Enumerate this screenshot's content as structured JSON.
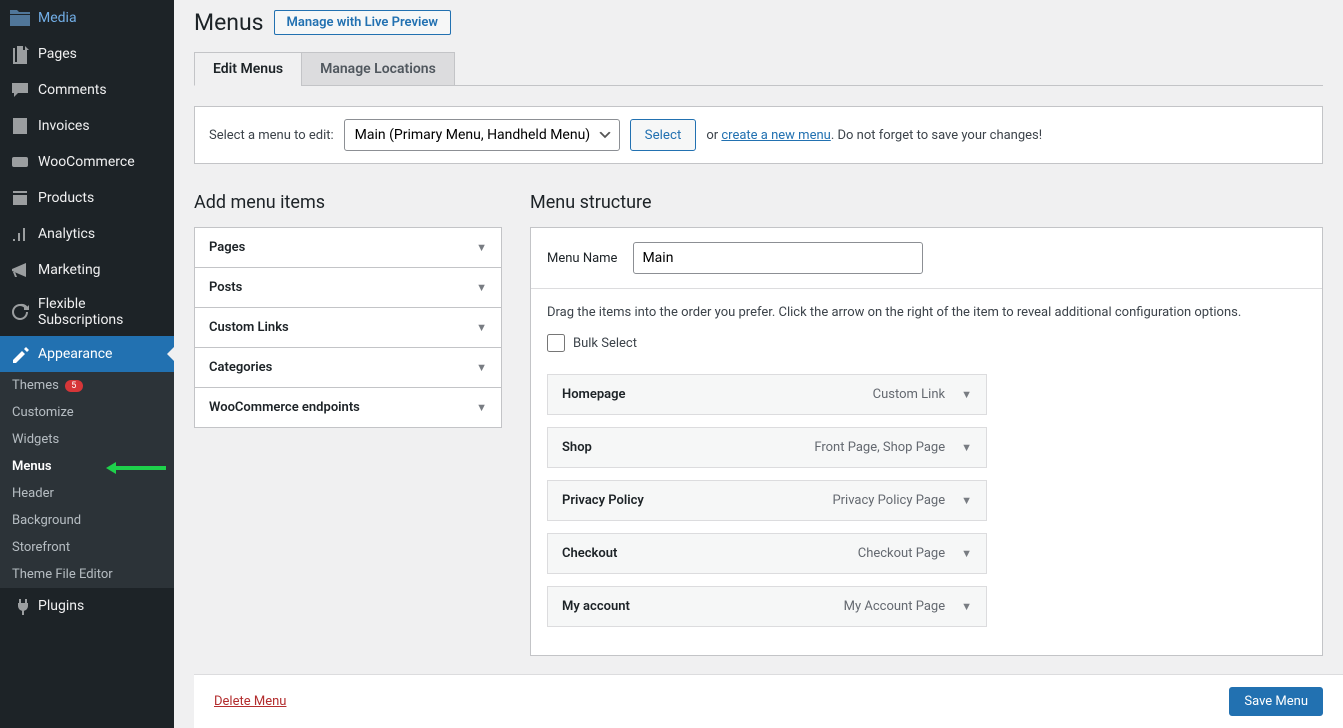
{
  "sidebar": {
    "media": "Media",
    "pages": "Pages",
    "comments": "Comments",
    "invoices": "Invoices",
    "woocommerce": "WooCommerce",
    "products": "Products",
    "analytics": "Analytics",
    "marketing": "Marketing",
    "flexible_subscriptions": "Flexible Subscriptions",
    "appearance": "Appearance",
    "themes": "Themes",
    "themes_badge": "5",
    "customize": "Customize",
    "widgets": "Widgets",
    "menus": "Menus",
    "header": "Header",
    "background": "Background",
    "storefront": "Storefront",
    "theme_file_editor": "Theme File Editor",
    "plugins": "Plugins"
  },
  "header": {
    "title": "Menus",
    "preview_btn": "Manage with Live Preview"
  },
  "tabs": {
    "edit": "Edit Menus",
    "locations": "Manage Locations"
  },
  "select_panel": {
    "label": "Select a menu to edit:",
    "selected": "Main (Primary Menu, Handheld Menu)",
    "select_btn": "Select",
    "or": "or",
    "create_link": "create a new menu",
    "trailing": ". Do not forget to save your changes!"
  },
  "add_items": {
    "title": "Add menu items",
    "pages": "Pages",
    "posts": "Posts",
    "custom_links": "Custom Links",
    "categories": "Categories",
    "woo_endpoints": "WooCommerce endpoints"
  },
  "menu_structure": {
    "title": "Menu structure",
    "name_label": "Menu Name",
    "name_value": "Main",
    "instructions": "Drag the items into the order you prefer. Click the arrow on the right of the item to reveal additional configuration options.",
    "bulk_select": "Bulk Select",
    "items": [
      {
        "label": "Homepage",
        "type": "Custom Link"
      },
      {
        "label": "Shop",
        "type": "Front Page, Shop Page"
      },
      {
        "label": "Privacy Policy",
        "type": "Privacy Policy Page"
      },
      {
        "label": "Checkout",
        "type": "Checkout Page"
      },
      {
        "label": "My account",
        "type": "My Account Page"
      }
    ]
  },
  "footer": {
    "delete": "Delete Menu",
    "save": "Save Menu"
  }
}
